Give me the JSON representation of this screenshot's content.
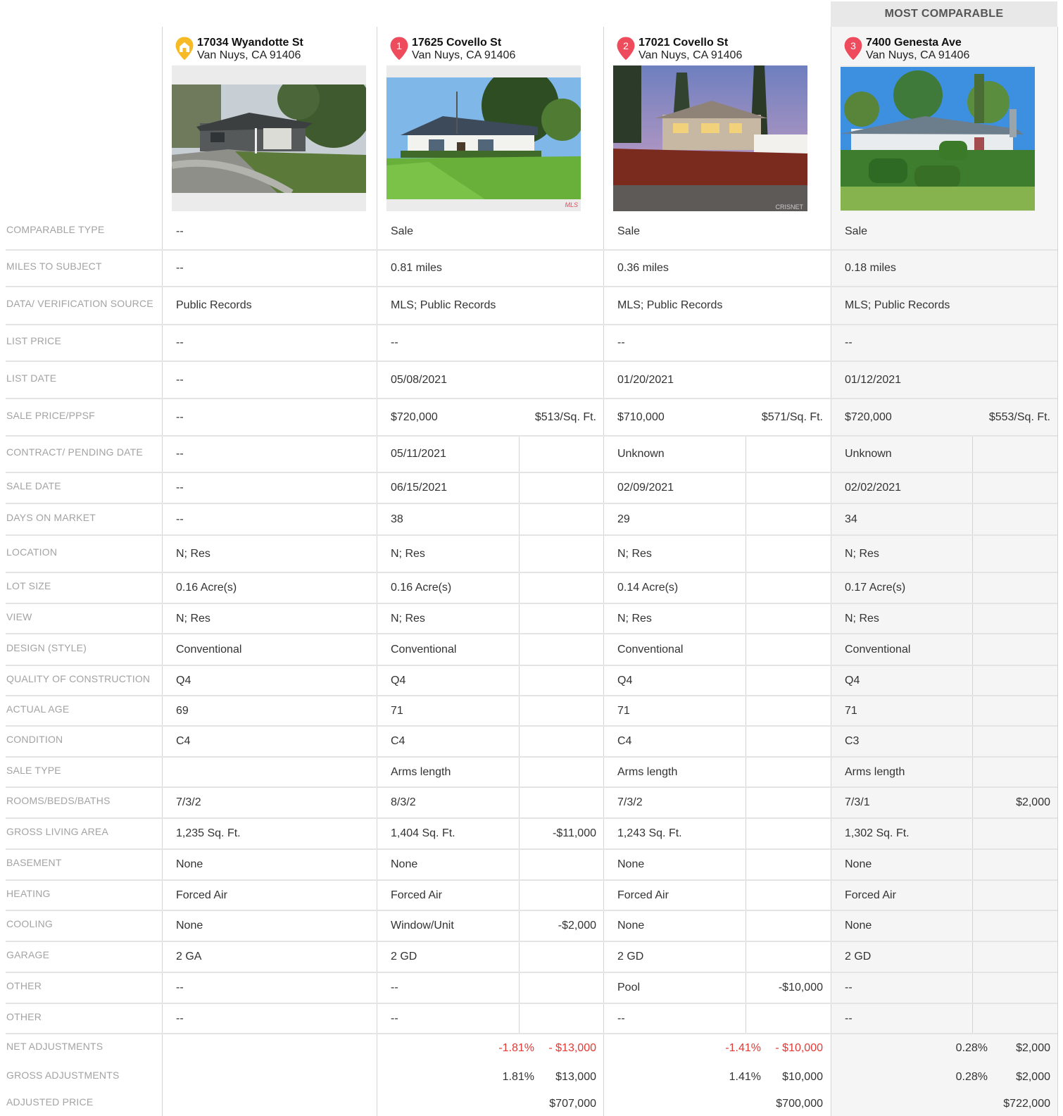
{
  "header": {
    "most_comparable": "MOST COMPARABLE"
  },
  "properties": [
    {
      "street": "17034 Wyandotte St",
      "city": "Van Nuys, CA 91406",
      "marker": "",
      "marker_icon": "home-pin-icon",
      "marker_color": "#f7b924"
    },
    {
      "street": "17625 Covello St",
      "city": "Van Nuys, CA 91406",
      "marker": "1",
      "marker_icon": "comp-pin-icon",
      "marker_color": "#ee4c5d",
      "photo_mark": "MLS"
    },
    {
      "street": "17021 Covello St",
      "city": "Van Nuys, CA 91406",
      "marker": "2",
      "marker_icon": "comp-pin-icon",
      "marker_color": "#ee4c5d",
      "photo_mark": "CRISNET"
    },
    {
      "street": "7400 Genesta Ave",
      "city": "Van Nuys, CA 91406",
      "marker": "3",
      "marker_icon": "comp-pin-icon",
      "marker_color": "#ee4c5d"
    }
  ],
  "rows": [
    {
      "label": "COMPARABLE TYPE",
      "values": [
        [
          "--",
          ""
        ],
        [
          "Sale",
          ""
        ],
        [
          "Sale",
          ""
        ],
        [
          "Sale",
          ""
        ]
      ]
    },
    {
      "label": "MILES TO SUBJECT",
      "values": [
        [
          "--",
          ""
        ],
        [
          "0.81 miles",
          ""
        ],
        [
          "0.36 miles",
          ""
        ],
        [
          "0.18 miles",
          ""
        ]
      ]
    },
    {
      "label": "DATA/ VERIFICATION SOURCE",
      "values": [
        [
          "Public Records",
          ""
        ],
        [
          "MLS; Public Records",
          ""
        ],
        [
          "MLS; Public Records",
          ""
        ],
        [
          "MLS; Public Records",
          ""
        ]
      ]
    },
    {
      "label": "LIST PRICE",
      "values": [
        [
          "--",
          ""
        ],
        [
          "--",
          ""
        ],
        [
          "--",
          ""
        ],
        [
          "--",
          ""
        ]
      ]
    },
    {
      "label": "LIST DATE",
      "values": [
        [
          "--",
          ""
        ],
        [
          "05/08/2021",
          ""
        ],
        [
          "01/20/2021",
          ""
        ],
        [
          "01/12/2021",
          ""
        ]
      ]
    },
    {
      "label": "SALE PRICE/PPSF",
      "values": [
        [
          "--",
          ""
        ],
        [
          "$720,000",
          "$513/Sq. Ft."
        ],
        [
          "$710,000",
          "$571/Sq. Ft."
        ],
        [
          "$720,000",
          "$553/Sq. Ft."
        ]
      ]
    },
    {
      "label": "CONTRACT/ PENDING DATE",
      "values": [
        [
          "--",
          ""
        ],
        [
          "05/11/2021",
          ""
        ],
        [
          "Unknown",
          ""
        ],
        [
          "Unknown",
          ""
        ]
      ]
    },
    {
      "label": "SALE DATE",
      "values": [
        [
          "--",
          ""
        ],
        [
          "06/15/2021",
          ""
        ],
        [
          "02/09/2021",
          ""
        ],
        [
          "02/02/2021",
          ""
        ]
      ]
    },
    {
      "label": "DAYS ON MARKET",
      "values": [
        [
          "--",
          ""
        ],
        [
          "38",
          ""
        ],
        [
          "29",
          ""
        ],
        [
          "34",
          ""
        ]
      ]
    },
    {
      "label": "LOCATION",
      "values": [
        [
          "N; Res",
          ""
        ],
        [
          "N; Res",
          ""
        ],
        [
          "N; Res",
          ""
        ],
        [
          "N; Res",
          ""
        ]
      ]
    },
    {
      "label": "LOT SIZE",
      "values": [
        [
          "0.16 Acre(s)",
          ""
        ],
        [
          "0.16 Acre(s)",
          ""
        ],
        [
          "0.14 Acre(s)",
          ""
        ],
        [
          "0.17 Acre(s)",
          ""
        ]
      ]
    },
    {
      "label": "VIEW",
      "values": [
        [
          "N; Res",
          ""
        ],
        [
          "N; Res",
          ""
        ],
        [
          "N; Res",
          ""
        ],
        [
          "N; Res",
          ""
        ]
      ]
    },
    {
      "label": "DESIGN (STYLE)",
      "values": [
        [
          "Conventional",
          ""
        ],
        [
          "Conventional",
          ""
        ],
        [
          "Conventional",
          ""
        ],
        [
          "Conventional",
          ""
        ]
      ]
    },
    {
      "label": "QUALITY OF CONSTRUCTION",
      "values": [
        [
          "Q4",
          ""
        ],
        [
          "Q4",
          ""
        ],
        [
          "Q4",
          ""
        ],
        [
          "Q4",
          ""
        ]
      ]
    },
    {
      "label": "ACTUAL AGE",
      "values": [
        [
          "69",
          ""
        ],
        [
          "71",
          ""
        ],
        [
          "71",
          ""
        ],
        [
          "71",
          ""
        ]
      ]
    },
    {
      "label": "CONDITION",
      "values": [
        [
          "C4",
          ""
        ],
        [
          "C4",
          ""
        ],
        [
          "C4",
          ""
        ],
        [
          "C3",
          ""
        ]
      ]
    },
    {
      "label": "SALE TYPE",
      "values": [
        [
          "",
          ""
        ],
        [
          "Arms length",
          ""
        ],
        [
          "Arms length",
          ""
        ],
        [
          "Arms length",
          ""
        ]
      ]
    },
    {
      "label": "ROOMS/BEDS/BATHS",
      "values": [
        [
          "7/3/2",
          ""
        ],
        [
          "8/3/2",
          ""
        ],
        [
          "7/3/2",
          ""
        ],
        [
          "7/3/1",
          "$2,000"
        ]
      ]
    },
    {
      "label": "GROSS LIVING AREA",
      "values": [
        [
          "1,235 Sq. Ft.",
          ""
        ],
        [
          "1,404 Sq. Ft.",
          "-$11,000"
        ],
        [
          "1,243 Sq. Ft.",
          ""
        ],
        [
          "1,302 Sq. Ft.",
          ""
        ]
      ]
    },
    {
      "label": "BASEMENT",
      "values": [
        [
          "None",
          ""
        ],
        [
          "None",
          ""
        ],
        [
          "None",
          ""
        ],
        [
          "None",
          ""
        ]
      ]
    },
    {
      "label": "HEATING",
      "values": [
        [
          "Forced Air",
          ""
        ],
        [
          "Forced Air",
          ""
        ],
        [
          "Forced Air",
          ""
        ],
        [
          "Forced Air",
          ""
        ]
      ]
    },
    {
      "label": "COOLING",
      "values": [
        [
          "None",
          ""
        ],
        [
          "Window/Unit",
          "-$2,000"
        ],
        [
          "None",
          ""
        ],
        [
          "None",
          ""
        ]
      ]
    },
    {
      "label": "GARAGE",
      "values": [
        [
          "2 GA",
          ""
        ],
        [
          "2 GD",
          ""
        ],
        [
          "2 GD",
          ""
        ],
        [
          "2 GD",
          ""
        ]
      ]
    },
    {
      "label": "OTHER",
      "values": [
        [
          "--",
          ""
        ],
        [
          "--",
          ""
        ],
        [
          "Pool",
          "-$10,000"
        ],
        [
          "--",
          ""
        ]
      ]
    },
    {
      "label": "OTHER",
      "values": [
        [
          "--",
          ""
        ],
        [
          "--",
          ""
        ],
        [
          "--",
          ""
        ],
        [
          "--",
          ""
        ]
      ]
    }
  ],
  "summary": [
    {
      "label": "NET ADJUSTMENTS",
      "values": [
        [
          "",
          ""
        ],
        [
          "-1.81%",
          "- $13,000"
        ],
        [
          "-1.41%",
          "- $10,000"
        ],
        [
          "0.28%",
          "$2,000"
        ]
      ],
      "negative": [
        false,
        true,
        true,
        false
      ]
    },
    {
      "label": "GROSS ADJUSTMENTS",
      "values": [
        [
          "",
          ""
        ],
        [
          "1.81%",
          "$13,000"
        ],
        [
          "1.41%",
          "$10,000"
        ],
        [
          "0.28%",
          "$2,000"
        ]
      ],
      "negative": [
        false,
        false,
        false,
        false
      ]
    },
    {
      "label": "ADJUSTED PRICE",
      "values": [
        [
          "",
          ""
        ],
        [
          "",
          "$707,000"
        ],
        [
          "",
          "$700,000"
        ],
        [
          "",
          "$722,000"
        ]
      ],
      "negative": [
        false,
        false,
        false,
        false
      ]
    }
  ]
}
